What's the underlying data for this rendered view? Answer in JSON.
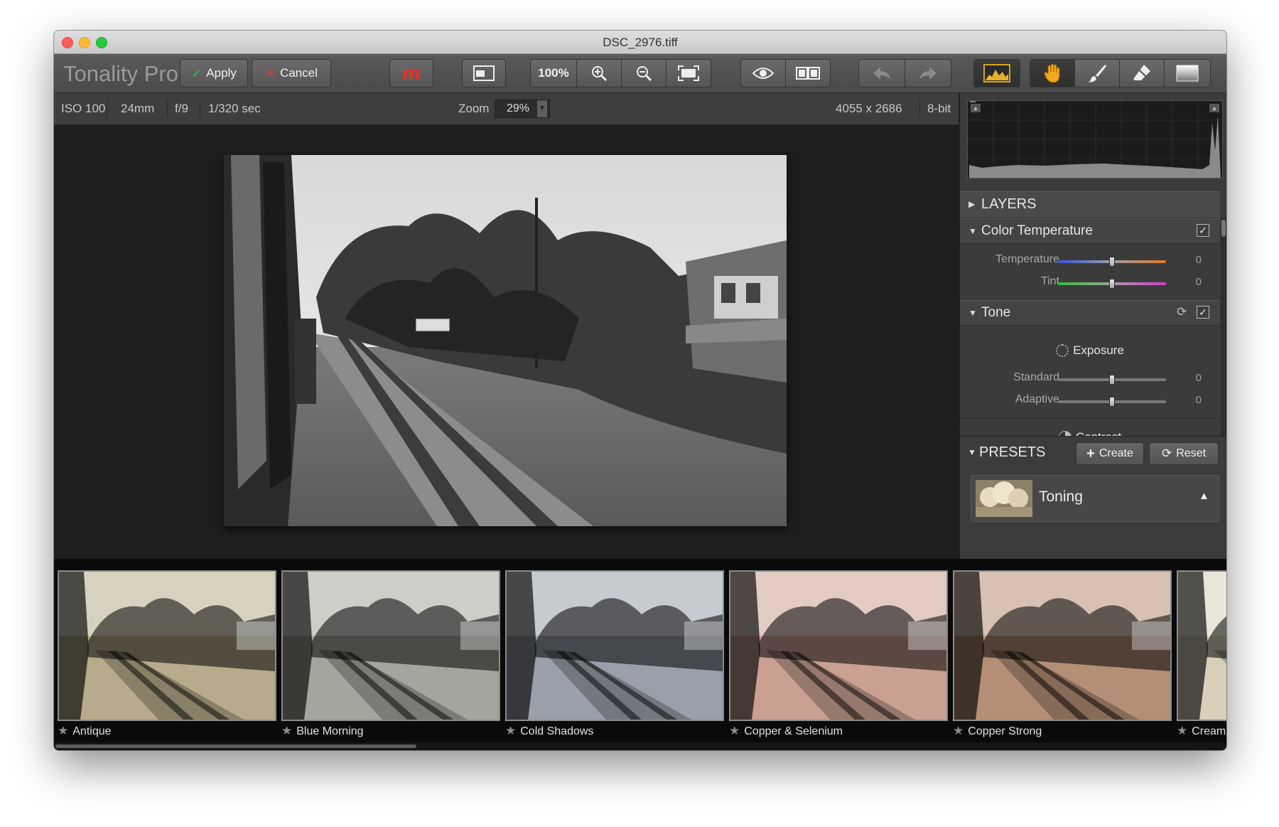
{
  "window": {
    "title": "DSC_2976.tiff"
  },
  "toolbar": {
    "app_name": "Tonality Pro",
    "apply_label": "Apply",
    "cancel_label": "Cancel",
    "zoom_100_label": "100%",
    "icons": [
      "logo-m-icon",
      "single-view-icon",
      "zoom-in-icon",
      "zoom-out-icon",
      "fit-screen-icon",
      "preview-eye-icon",
      "split-view-icon",
      "undo-icon",
      "redo-icon",
      "histogram-icon",
      "hand-icon",
      "brush-icon",
      "eraser-icon",
      "gradient-icon"
    ]
  },
  "infobar": {
    "iso": "ISO 100",
    "focal": "24mm",
    "aperture": "f/9",
    "shutter": "1/320 sec",
    "zoom_label": "Zoom",
    "zoom_value": "29%",
    "dimensions": "4055 x 2686",
    "bitdepth": "8-bit"
  },
  "panel": {
    "layers_label": "LAYERS",
    "color_temperature": {
      "label": "Color Temperature",
      "enabled": true,
      "temperature_label": "Temperature",
      "temperature_value": "0",
      "tint_label": "Tint",
      "tint_value": "0"
    },
    "tone": {
      "label": "Tone",
      "enabled": true,
      "exposure_label": "Exposure",
      "standard_label": "Standard",
      "standard_value": "0",
      "adaptive_label": "Adaptive",
      "adaptive_value": "0",
      "contrast_label": "Contrast"
    },
    "presets": {
      "label": "PRESETS",
      "create_label": "Create",
      "reset_label": "Reset",
      "selected_category": "Toning"
    }
  },
  "filmstrip": {
    "items": [
      {
        "label": "Antique",
        "tint": "#b6ab8a"
      },
      {
        "label": "Blue Morning",
        "tint": "#a3a69c"
      },
      {
        "label": "Cold Shadows",
        "tint": "#9aa0aa"
      },
      {
        "label": "Copper & Selenium",
        "tint": "#c9a092"
      },
      {
        "label": "Copper Strong",
        "tint": "#b48f76"
      },
      {
        "label": "Cream",
        "tint": "#d8cfb9"
      }
    ]
  },
  "colors": {
    "apply_check": "#35c13a",
    "cancel_x": "#e23b2c",
    "logo_m": "#e5322b"
  }
}
